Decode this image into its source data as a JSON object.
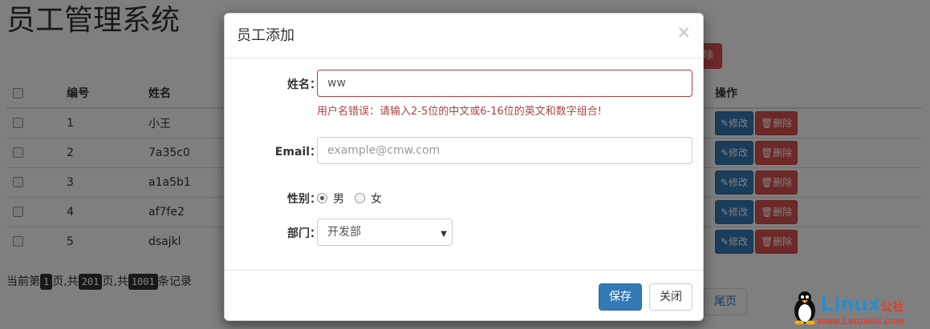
{
  "page": {
    "title": "员工管理系统",
    "top_delete_label": "除",
    "table": {
      "headers": [
        "编号",
        "姓名",
        "操作"
      ],
      "rows": [
        {
          "no": "1",
          "name": "小王"
        },
        {
          "no": "2",
          "name": "7a35c0"
        },
        {
          "no": "3",
          "name": "a1a5b1"
        },
        {
          "no": "4",
          "name": "af7fe2"
        },
        {
          "no": "5",
          "name": "dsajkl"
        }
      ],
      "edit_label": "✎修改",
      "delete_label": "🗑删除"
    },
    "pager": {
      "prefix": "当前第",
      "current_page": "1",
      "mid1": "页,共",
      "total_pages": "201",
      "mid2": "页,共",
      "total_records": "1001",
      "suffix": "条记录",
      "last_button": "尾页"
    }
  },
  "modal": {
    "title": "员工添加",
    "close_glyph": "×",
    "name_label": "姓名：",
    "name_value": "ww",
    "name_error": "用户名错误：请输入2-5位的中文或6-16位的英文和数字组合!",
    "email_label": "Email：",
    "email_placeholder": "example@cmw.com",
    "gender_label": "性别：",
    "gender_options": [
      "男",
      "女"
    ],
    "gender_selected": "男",
    "dept_label": "部门：",
    "dept_selected": "开发部",
    "save_label": "保存",
    "close_label": "关闭"
  },
  "watermark": {
    "brand": "Linux",
    "brand_suffix": "公社",
    "url": "www.Linuxidc.com"
  },
  "colors": {
    "primary": "#337ab7",
    "danger": "#d9534f",
    "error_text": "#a94442"
  }
}
